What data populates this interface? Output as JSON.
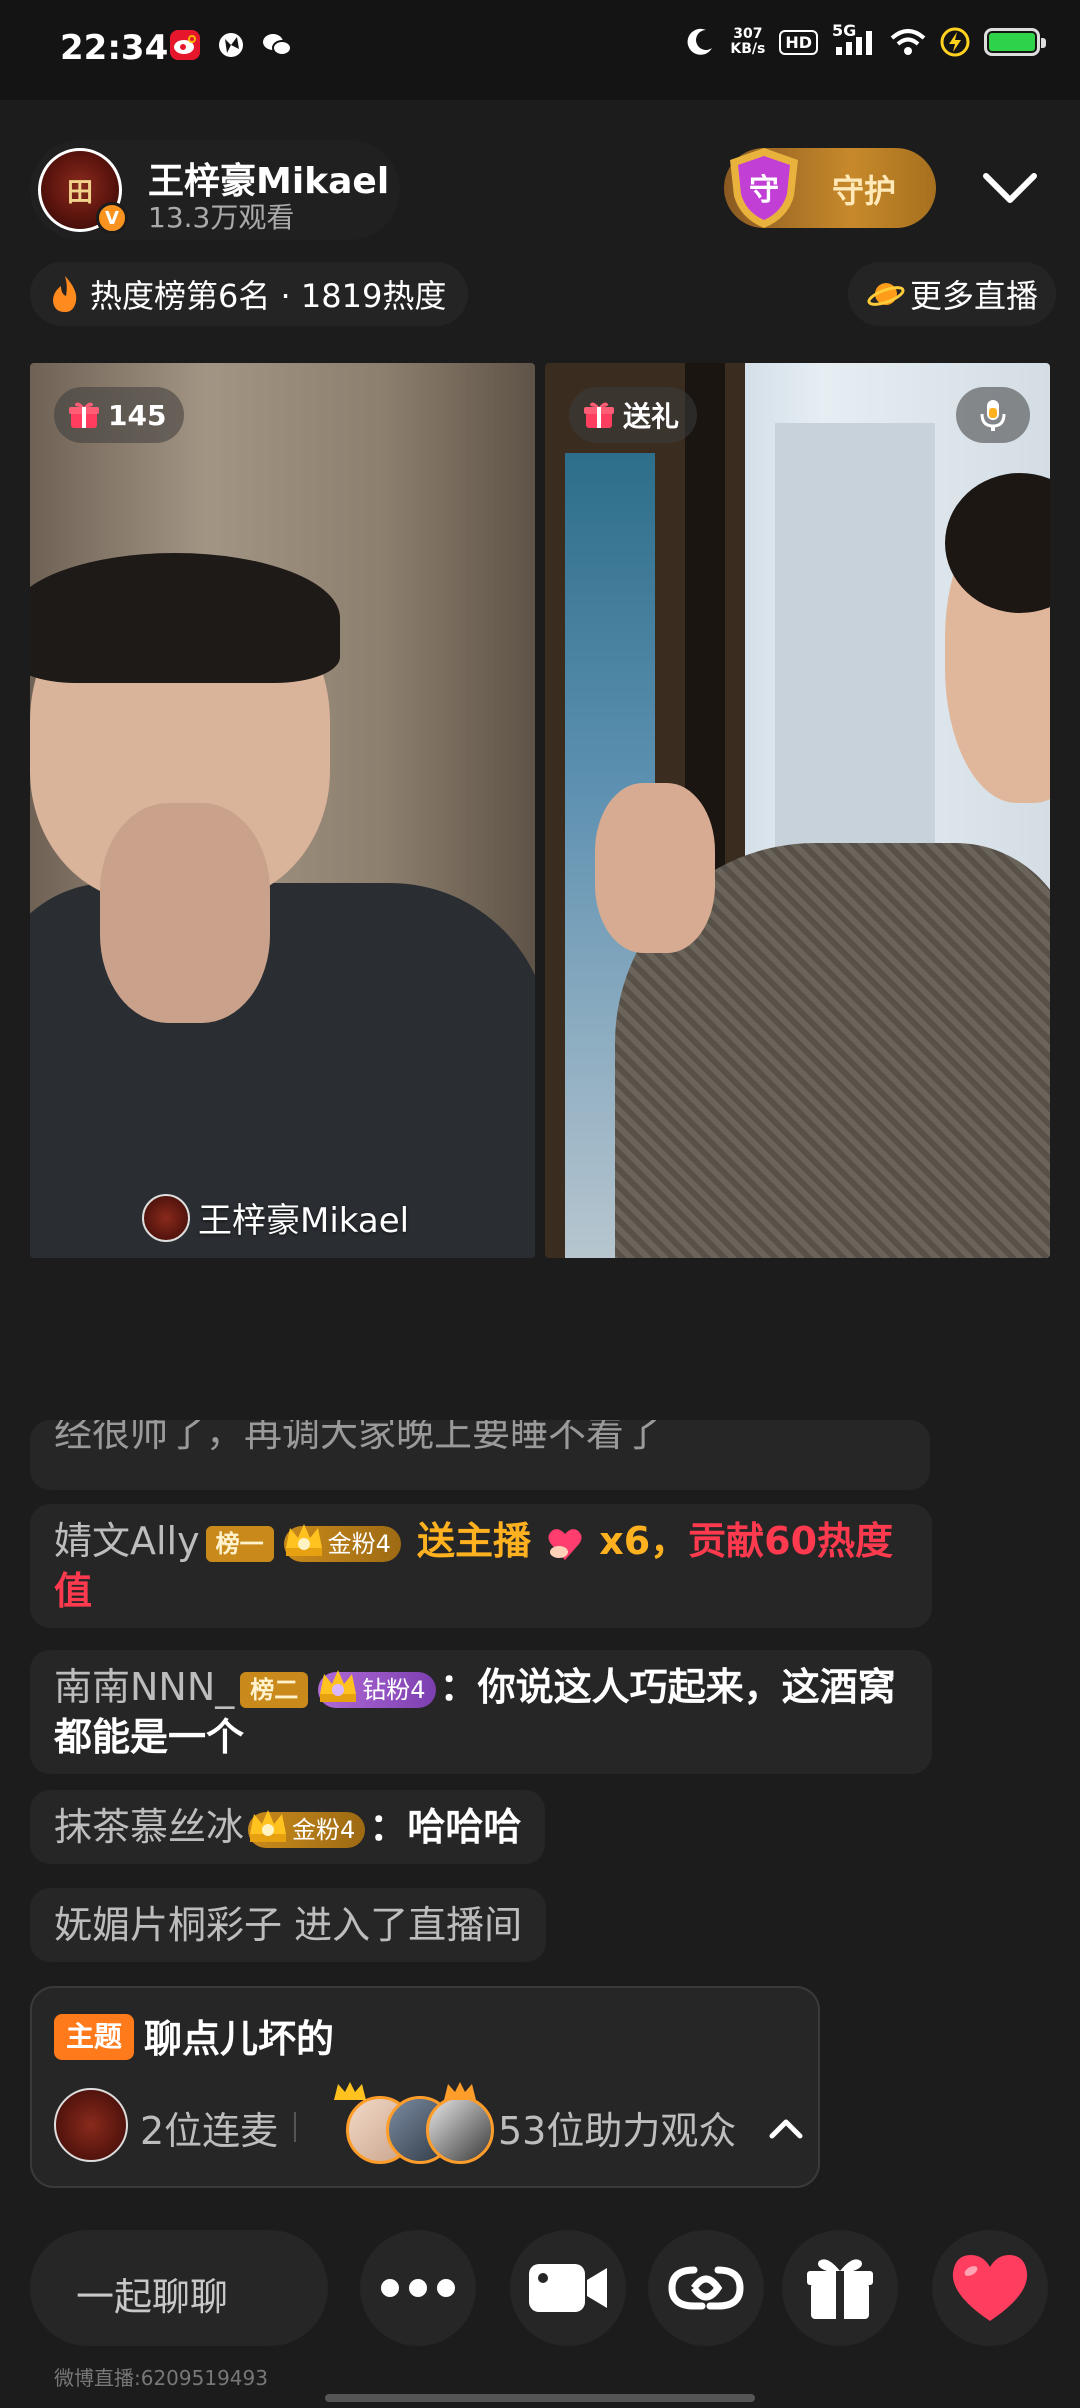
{
  "status_bar": {
    "time": "22:34",
    "speed_value": "307",
    "speed_unit": "KB/s",
    "hd": "HD",
    "network": "5G"
  },
  "header": {
    "host_name": "王梓豪Mikael",
    "viewers": "13.3万观看",
    "avatar_text": "田",
    "guard_label": "守护",
    "guard_shield_text": "守",
    "heat_label": "热度榜第6名 · 1819热度",
    "more_live_label": "更多直播"
  },
  "videos": {
    "left_gift_count": "145",
    "right_gift_label": "送礼",
    "left_name_tag": "王梓豪Mikael"
  },
  "chat": {
    "cut_message": "经很帅了，再调大家晚上要睡不着了",
    "messages": [
      {
        "user": "婧文Ally",
        "rank_badge": "榜一",
        "fan_badge": "金粉4",
        "gift_text": "送主播",
        "gift_count": "x6，",
        "contribution": "贡献60热度值"
      },
      {
        "user": "南南NNN_",
        "rank_badge": "榜二",
        "fan_badge": "钻粉4",
        "text": "你说这人巧起来，这酒窝都能是一个"
      },
      {
        "user": "抹茶慕丝冰",
        "fan_badge": "金粉4",
        "text": "哈哈哈"
      },
      {
        "user": "妩媚片桐彩子",
        "text": "进入了直播间"
      }
    ],
    "colon": "："
  },
  "topic": {
    "tag": "主题",
    "title": "聊点儿坏的",
    "lianmai": "2位连麦",
    "helpers": "53位助力观众"
  },
  "bottom_bar": {
    "chat_placeholder": "一起聊聊"
  },
  "footer": {
    "live_id": "微博直播:6209519493"
  },
  "colors": {
    "accent_orange": "#ff7a1a",
    "gift_yellow": "#ffb11f",
    "contribution_red": "#ff3a4f",
    "like_heart": "#ff3d5e"
  }
}
